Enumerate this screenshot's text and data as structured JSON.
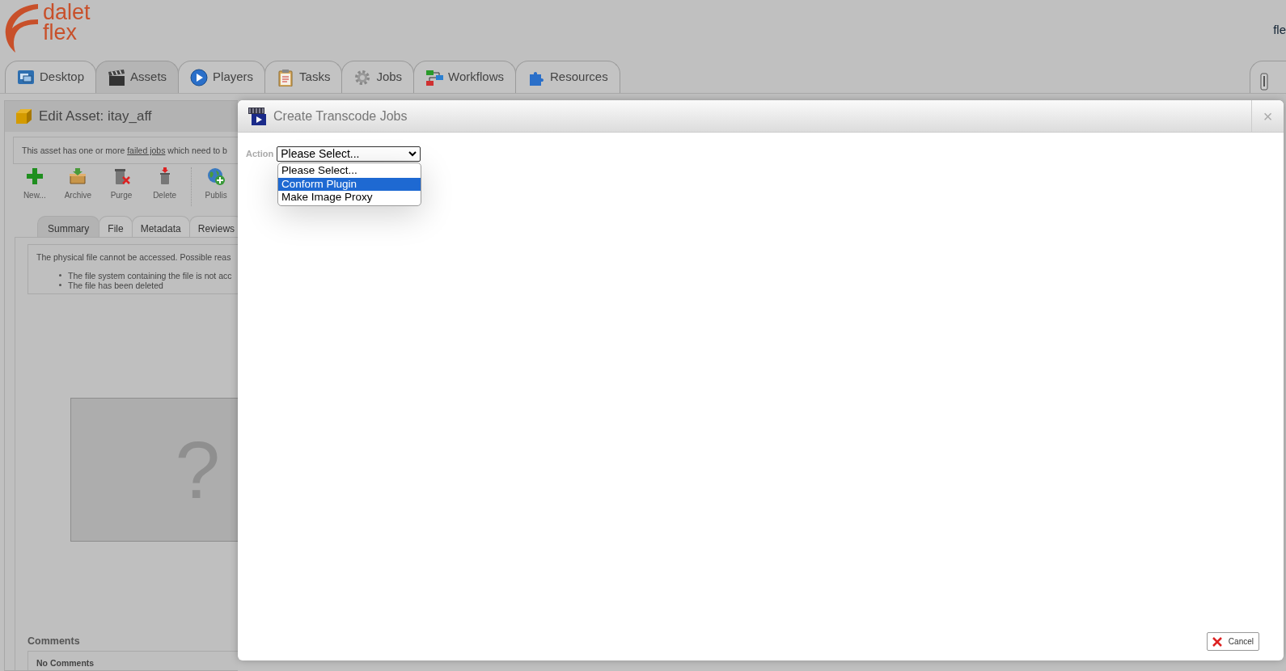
{
  "logo": {
    "line_1": "dalet",
    "line_2": "flex"
  },
  "user_text": "fle",
  "main_tabs": [
    {
      "label": "Desktop",
      "selected": false
    },
    {
      "label": "Assets",
      "selected": true
    },
    {
      "label": "Players",
      "selected": false
    },
    {
      "label": "Tasks",
      "selected": false
    },
    {
      "label": "Jobs",
      "selected": false
    },
    {
      "label": "Workflows",
      "selected": false
    },
    {
      "label": "Resources",
      "selected": false
    }
  ],
  "asset_panel": {
    "title": "Edit Asset: itay_aff",
    "notice": {
      "before": "This asset has one or more",
      "link": "failed jobs",
      "after": "which need to b"
    },
    "toolbar": [
      "New...",
      "Archive",
      "Purge",
      "Delete",
      "Publis"
    ],
    "sub_tabs": [
      {
        "label": "Summary",
        "selected": true
      },
      {
        "label": "File",
        "selected": false
      },
      {
        "label": "Metadata",
        "selected": false
      },
      {
        "label": "Reviews",
        "selected": false
      }
    ],
    "message": {
      "text": "The physical file cannot be accessed. Possible reas",
      "reasons": [
        "The file system containing the file is not acc",
        "The file has been deleted"
      ]
    },
    "preview": {
      "glyph": "?"
    },
    "comments": {
      "heading": "Comments",
      "text": "No Comments"
    }
  },
  "dialog": {
    "title": "Create Transcode Jobs",
    "close": "×",
    "action_label": "Action",
    "select_value": "Please Select...",
    "expanded": true,
    "options": [
      {
        "label": "Please Select...",
        "selected": false
      },
      {
        "label": "Conform Plugin",
        "selected": true
      },
      {
        "label": "Make Image Proxy",
        "selected": false
      }
    ],
    "cancel": "Cancel"
  }
}
